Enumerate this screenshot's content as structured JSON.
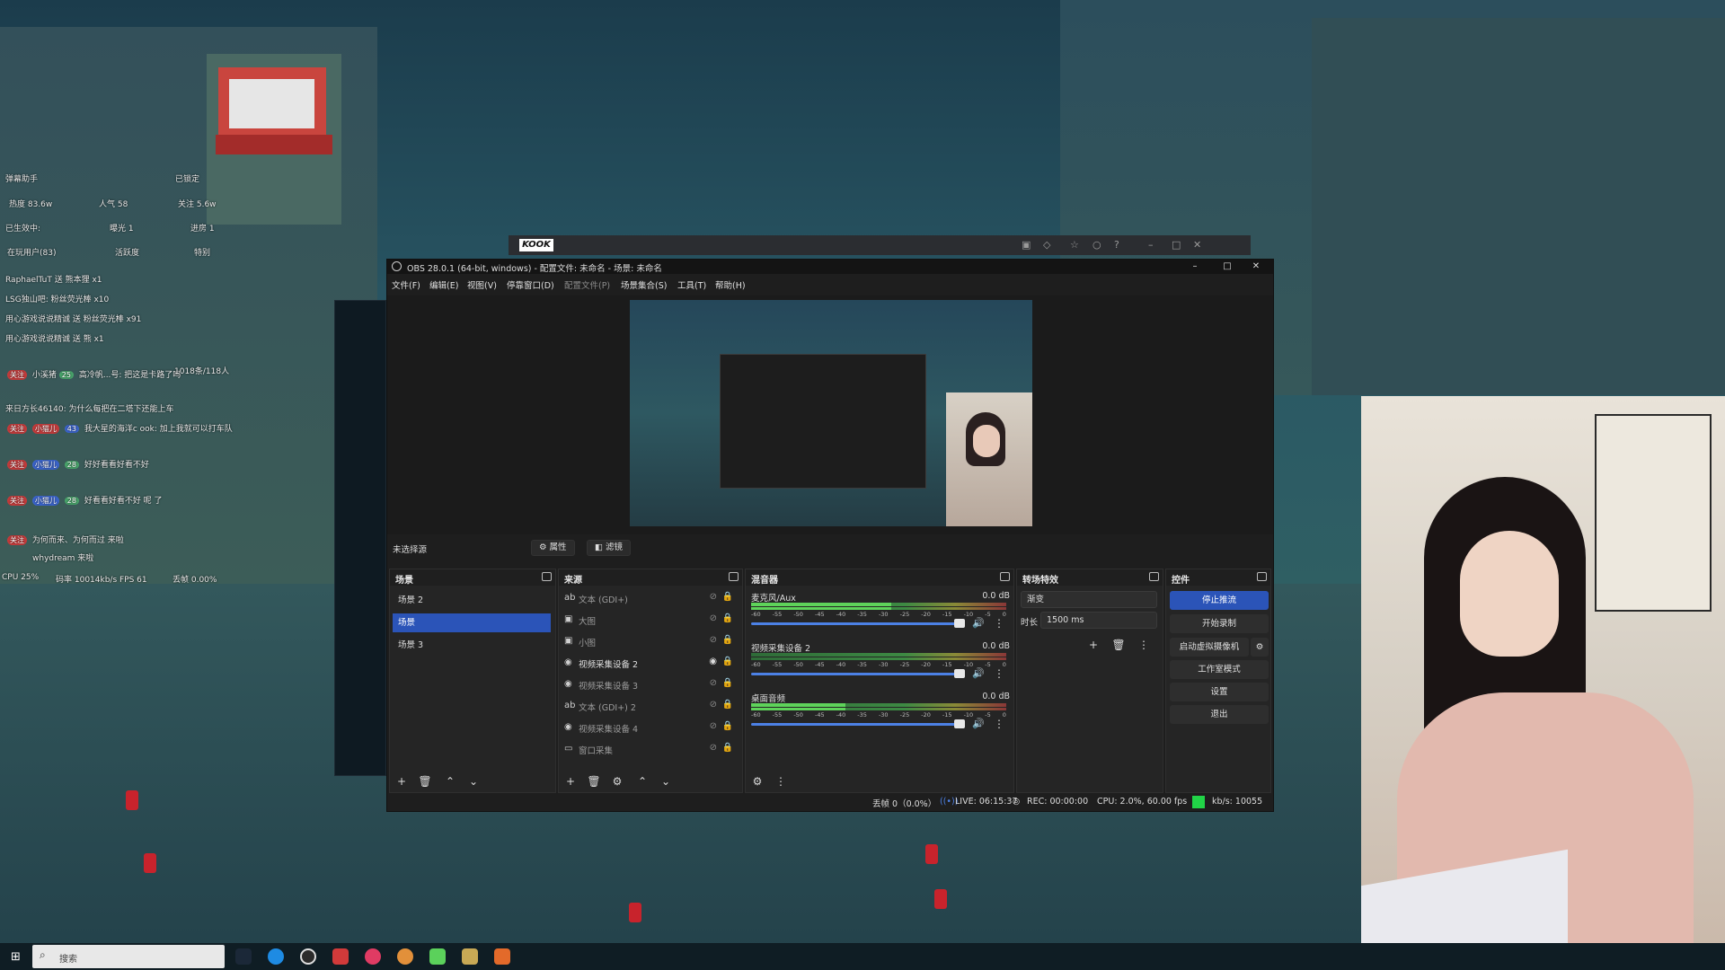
{
  "kook": {
    "logo": "KOOK"
  },
  "chat": {
    "rows": [
      "弹幕助手",
      "已锁定",
      "热度 83.6w",
      "人气 58",
      "关注 5.6w",
      "已生效中:",
      "曝光 1",
      "进房 1",
      "在玩用户(83)",
      "活跃度",
      "特别",
      "RaphaelTuT 送 熊本狸 x1",
      "LSG独山吧: 粉丝荧光棒 x10",
      "用心游戏说说精诚 送 粉丝荧光棒 x91",
      "用心游戏说说精诚 送 熊 x1",
      "关注",
      "小溪猪",
      "25",
      "高冷帆...号: 把这是卡路了吗",
      "1018条/118人",
      "来日方长46140: 为什么每把在二塔下还能上车",
      "关注",
      "小猫儿",
      "43",
      "我大星的海洋c ook: 加上我就可以打车队",
      "关注",
      "小猫儿",
      "28",
      "好好看看好看不好",
      "关注",
      "小猫儿",
      "28",
      "好看看好看不好 呢 了",
      "关注",
      "为何而来、为何而过 来啦",
      "whydream 来啦",
      "CPU 25%",
      "码率 10014kb/s FPS 61",
      "丢帧 0.00%"
    ]
  },
  "obs": {
    "title": "OBS 28.0.1 (64-bit, windows) - 配置文件: 未命名 - 场景: 未命名",
    "menu": [
      "文件(F)",
      "编辑(E)",
      "视图(V)",
      "停靠窗口(D)",
      "配置文件(P)",
      "场景集合(S)",
      "工具(T)",
      "帮助(H)"
    ],
    "no_source": "未选择源",
    "properties_btn": "属性",
    "filters_btn": "滤镜",
    "scenes": {
      "title": "场景",
      "items": [
        "场景 2",
        "场景",
        "场景 3"
      ]
    },
    "sources": {
      "title": "来源",
      "items": [
        "文本 (GDI+)",
        "大图",
        "小图",
        "视频采集设备 2",
        "视频采集设备 3",
        "文本 (GDI+) 2",
        "视频采集设备 4",
        "窗口采集"
      ]
    },
    "mixer": {
      "title": "混音器",
      "ticks": [
        "-60",
        "-55",
        "-50",
        "-45",
        "-40",
        "-35",
        "-30",
        "-25",
        "-20",
        "-15",
        "-10",
        "-5",
        "0"
      ],
      "channels": [
        {
          "name": "麦克风/Aux",
          "db": "0.0 dB",
          "level": 0.55
        },
        {
          "name": "视频采集设备 2",
          "db": "0.0 dB",
          "level": 0
        },
        {
          "name": "桌面音频",
          "db": "0.0 dB",
          "level": 0.37
        }
      ]
    },
    "transitions": {
      "title": "转场特效",
      "selected": "渐变",
      "duration_label": "时长",
      "duration": "1500 ms"
    },
    "controls": {
      "title": "控件",
      "stop_stream": "停止推流",
      "start_record": "开始录制",
      "virtual_cam": "启动虚拟摄像机",
      "studio_mode": "工作室模式",
      "settings": "设置",
      "exit": "退出"
    },
    "status": {
      "dropped": "丢帧 0（0.0%）",
      "live": "LIVE: 06:15:37",
      "rec": "REC: 00:00:00",
      "cpu": "CPU: 2.0%, 60.00 fps",
      "kbps": "kb/s: 10055"
    }
  },
  "taskbar": {
    "search_placeholder": "搜索"
  },
  "colors": {
    "accent": "#2b54b8",
    "live_green": "#21d447",
    "meter_green": "#5ed35a"
  }
}
